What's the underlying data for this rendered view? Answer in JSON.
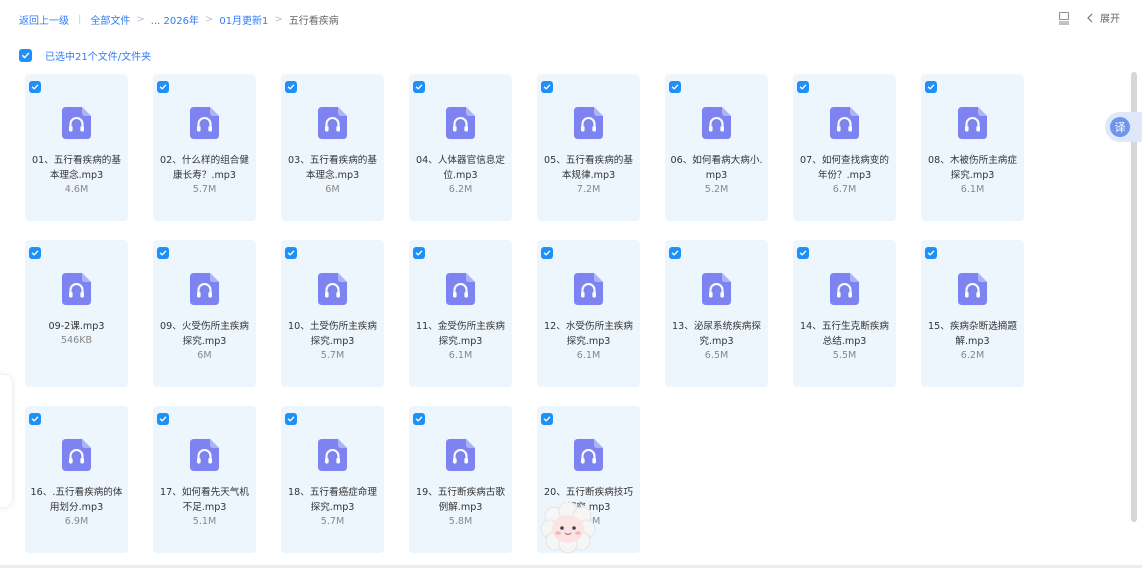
{
  "breadcrumb": {
    "back": "返回上一级",
    "items": [
      {
        "label": "全部文件",
        "current": false
      },
      {
        "label": "... 2026年",
        "current": false
      },
      {
        "label": "01月更新1",
        "current": false
      },
      {
        "label": "五行看疾病",
        "current": true
      }
    ]
  },
  "toolbar": {
    "view_icon": "list-view-icon",
    "expand_label": "展开",
    "expand_icon": "chevron-left-icon"
  },
  "selection": {
    "checked": true,
    "text": "已选中21个文件/文件夹"
  },
  "colors": {
    "accent": "#2f7cf6",
    "checkbox": "#1f90f5",
    "card_bg": "#eef6fd",
    "audio_icon": "#7d83f1"
  },
  "file_icon": "audio-file-icon",
  "files": [
    {
      "name": "01、五行看疾病的基本理念.mp3",
      "size": "4.6M",
      "checked": true
    },
    {
      "name": "02、什么样的组合健康长寿？.mp3",
      "size": "5.7M",
      "checked": true
    },
    {
      "name": "03、五行看疾病的基本理念.mp3",
      "size": "6M",
      "checked": true
    },
    {
      "name": "04、人体器官信息定位.mp3",
      "size": "6.2M",
      "checked": true
    },
    {
      "name": "05、五行看疾病的基本规律.mp3",
      "size": "7.2M",
      "checked": true
    },
    {
      "name": "06、如何看病大病小.mp3",
      "size": "5.2M",
      "checked": true
    },
    {
      "name": "07、如何查找病变的年份？.mp3",
      "size": "6.7M",
      "checked": true
    },
    {
      "name": "08、木被伤所主病症探究.mp3",
      "size": "6.1M",
      "checked": true
    },
    {
      "name": "09-2课.mp3",
      "size": "546KB",
      "checked": true
    },
    {
      "name": "09、火受伤所主疾病探究.mp3",
      "size": "6M",
      "checked": true
    },
    {
      "name": "10、土受伤所主疾病探究.mp3",
      "size": "5.7M",
      "checked": true
    },
    {
      "name": "11、金受伤所主疾病探究.mp3",
      "size": "6.1M",
      "checked": true
    },
    {
      "name": "12、水受伤所主疾病探究.mp3",
      "size": "6.1M",
      "checked": true
    },
    {
      "name": "13、泌尿系统疾病探究.mp3",
      "size": "6.5M",
      "checked": true
    },
    {
      "name": "14、五行生克断疾病总结.mp3",
      "size": "5.5M",
      "checked": true
    },
    {
      "name": "15、疾病杂断选摘题解.mp3",
      "size": "6.2M",
      "checked": true
    },
    {
      "name": "16、.五行看疾病的体用划分.mp3",
      "size": "6.9M",
      "checked": true
    },
    {
      "name": "17、如何看先天气机不足.mp3",
      "size": "5.1M",
      "checked": true
    },
    {
      "name": "18、五行看癌症命理探究.mp3",
      "size": "5.7M",
      "checked": true
    },
    {
      "name": "19、五行断疾病古歌例解.mp3",
      "size": "5.8M",
      "checked": true
    },
    {
      "name": "20、五行断疾病技巧探究.mp3",
      "size": "6.2M",
      "checked": true
    }
  ],
  "floating": {
    "translate_label": "译"
  }
}
